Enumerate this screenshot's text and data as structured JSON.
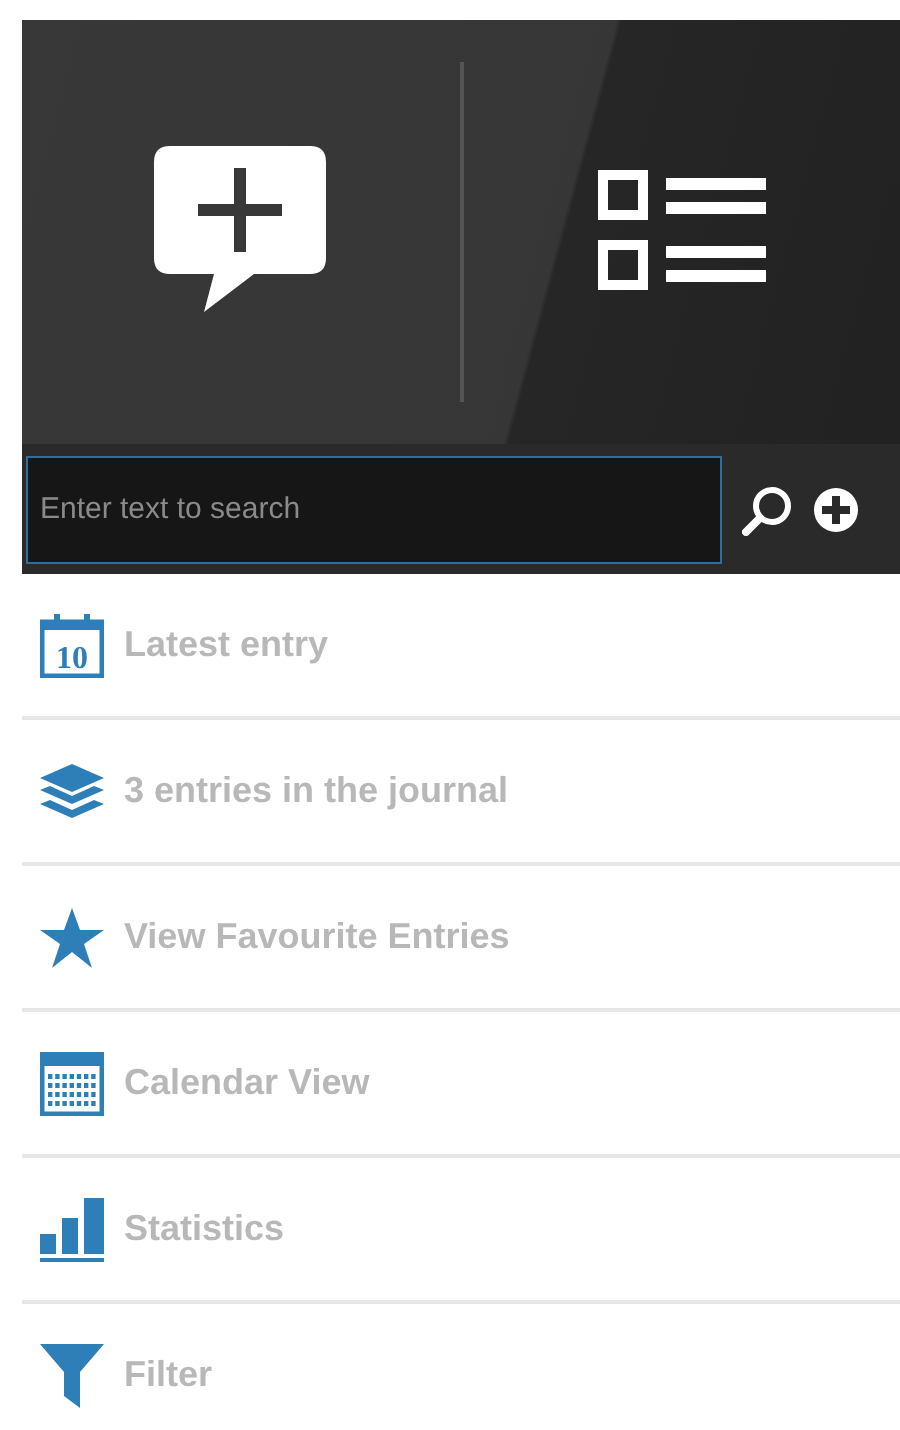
{
  "search": {
    "placeholder": "Enter text to search"
  },
  "menu": [
    {
      "kind": "day",
      "label": "Latest entry",
      "icon_text": "10"
    },
    {
      "kind": "layers",
      "label": "3 entries in the journal"
    },
    {
      "kind": "star",
      "label": "View Favourite Entries"
    },
    {
      "kind": "calendar",
      "label": "Calendar View"
    },
    {
      "kind": "stats",
      "label": "Statistics"
    },
    {
      "kind": "filter",
      "label": "Filter"
    }
  ]
}
